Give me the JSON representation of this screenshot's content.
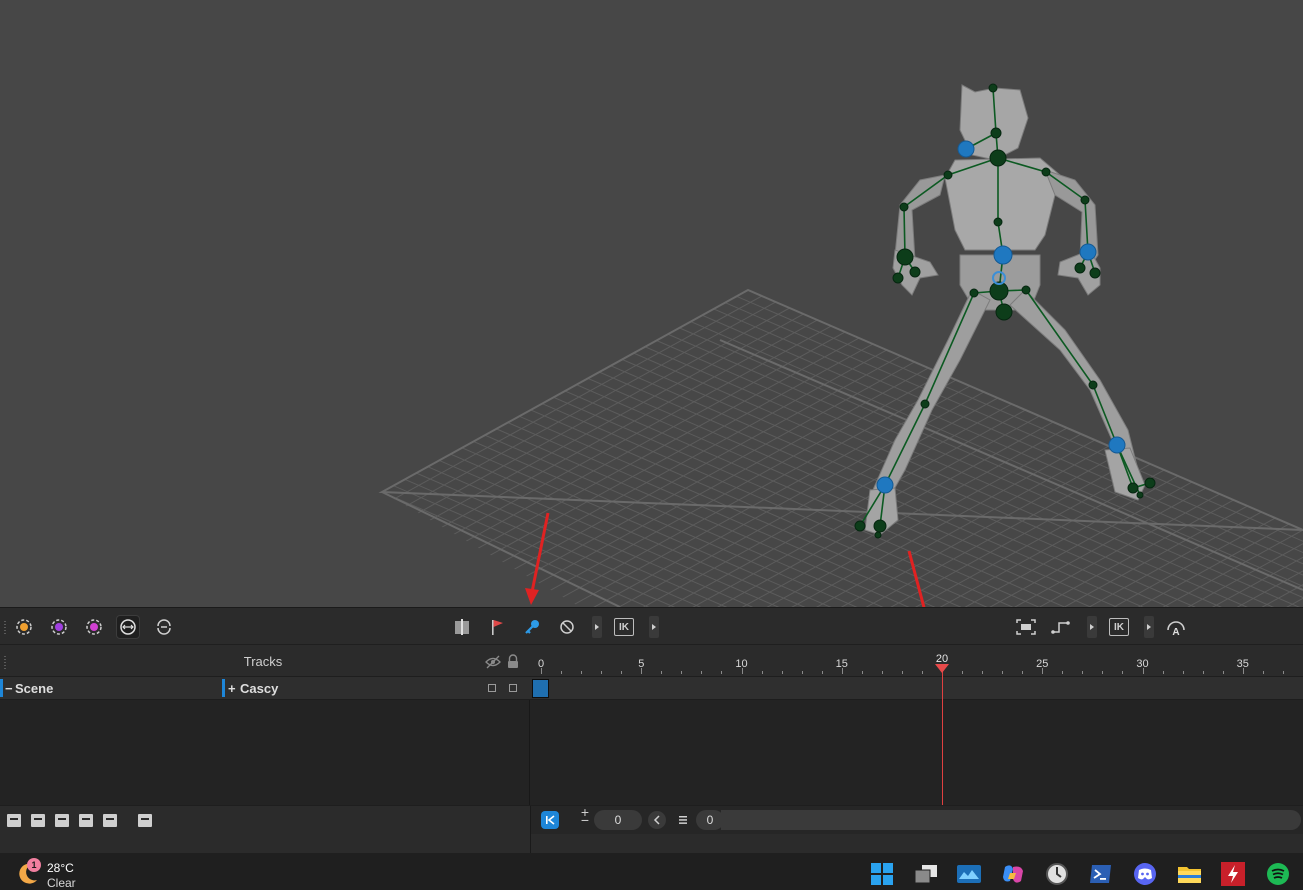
{
  "toolbar": {
    "left_tools": [
      "move-gizmo-icon",
      "rotate-gizmo-icon",
      "scale-gizmo-icon",
      "symmetry-icon",
      "reset-pose-icon"
    ],
    "center_tools": [
      "marker-icon",
      "flag-icon",
      "key-icon",
      "no-key-icon"
    ],
    "ik_label_left": "IK",
    "ik_label_right": "IK",
    "right_tools": [
      "frame-selection-icon",
      "step-curve-icon",
      "auto-key-icon"
    ],
    "accent_color": "#1e86d8"
  },
  "tracks": {
    "title": "Tracks",
    "scene_label": "Scene",
    "scene_prefix": "−",
    "track_label": "Cascy",
    "track_prefix": "+"
  },
  "timeline": {
    "tick_labels": [
      "0",
      "5",
      "10",
      "15",
      "20",
      "25",
      "30",
      "35"
    ],
    "current_frame": "20",
    "playhead_color": "#e84a4a"
  },
  "bottom": {
    "frame_value": "0",
    "list_value": "0",
    "plus_label": "+",
    "minus_label": "−"
  },
  "taskbar": {
    "weather_badge": "1",
    "weather_temp": "28°C",
    "weather_cond": "Clear",
    "apps": [
      "windows-start-icon",
      "task-view-icon",
      "photo-app-icon",
      "copilot-icon",
      "clock-app-icon",
      "terminal-icon",
      "discord-icon",
      "file-explorer-icon",
      "flash-app-icon",
      "spotify-icon"
    ]
  }
}
